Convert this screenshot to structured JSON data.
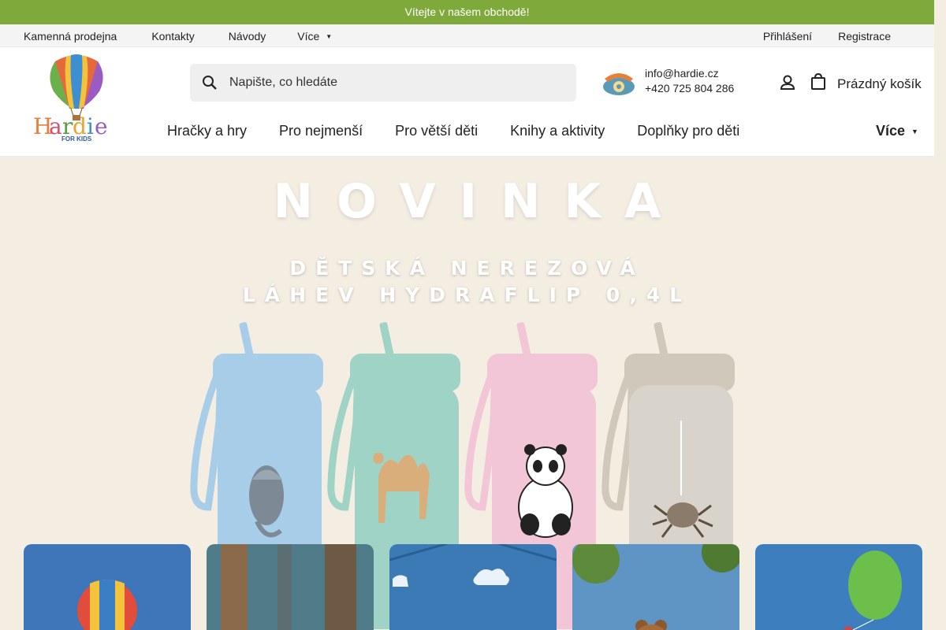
{
  "promo": {
    "text": "Vítejte v našem obchodě!"
  },
  "top_nav": {
    "left": [
      "Kamenná prodejna",
      "Kontakty",
      "Návody",
      "Více"
    ],
    "right": [
      "Přihlášení",
      "Registrace"
    ]
  },
  "logo": {
    "name": "Hardie",
    "tagline": "FOR KIDS"
  },
  "search": {
    "placeholder": "Napište, co hledáte"
  },
  "contact": {
    "email": "info@hardie.cz",
    "phone": "+420 725 804 286"
  },
  "cart": {
    "label": "Prázdný košík"
  },
  "main_nav": {
    "items": [
      "Hračky a hry",
      "Pro nejmenší",
      "Pro větší děti",
      "Knihy a aktivity",
      "Doplňky pro děti"
    ],
    "more": "Více"
  },
  "hero": {
    "title": "NOVINKA",
    "subtitle_line1": "DĚTSKÁ NEREZOVÁ",
    "subtitle_line2": "LÁHEV HYDRAFLIP 0,4L"
  },
  "colors": {
    "promo_bg": "#7fa93a",
    "hero_bg": "#f4ede2",
    "bottle_blue": "#a8cde9",
    "bottle_mint": "#9fd3c5",
    "bottle_pink": "#f2c6d6",
    "bottle_sand": "#cfc8bb"
  }
}
